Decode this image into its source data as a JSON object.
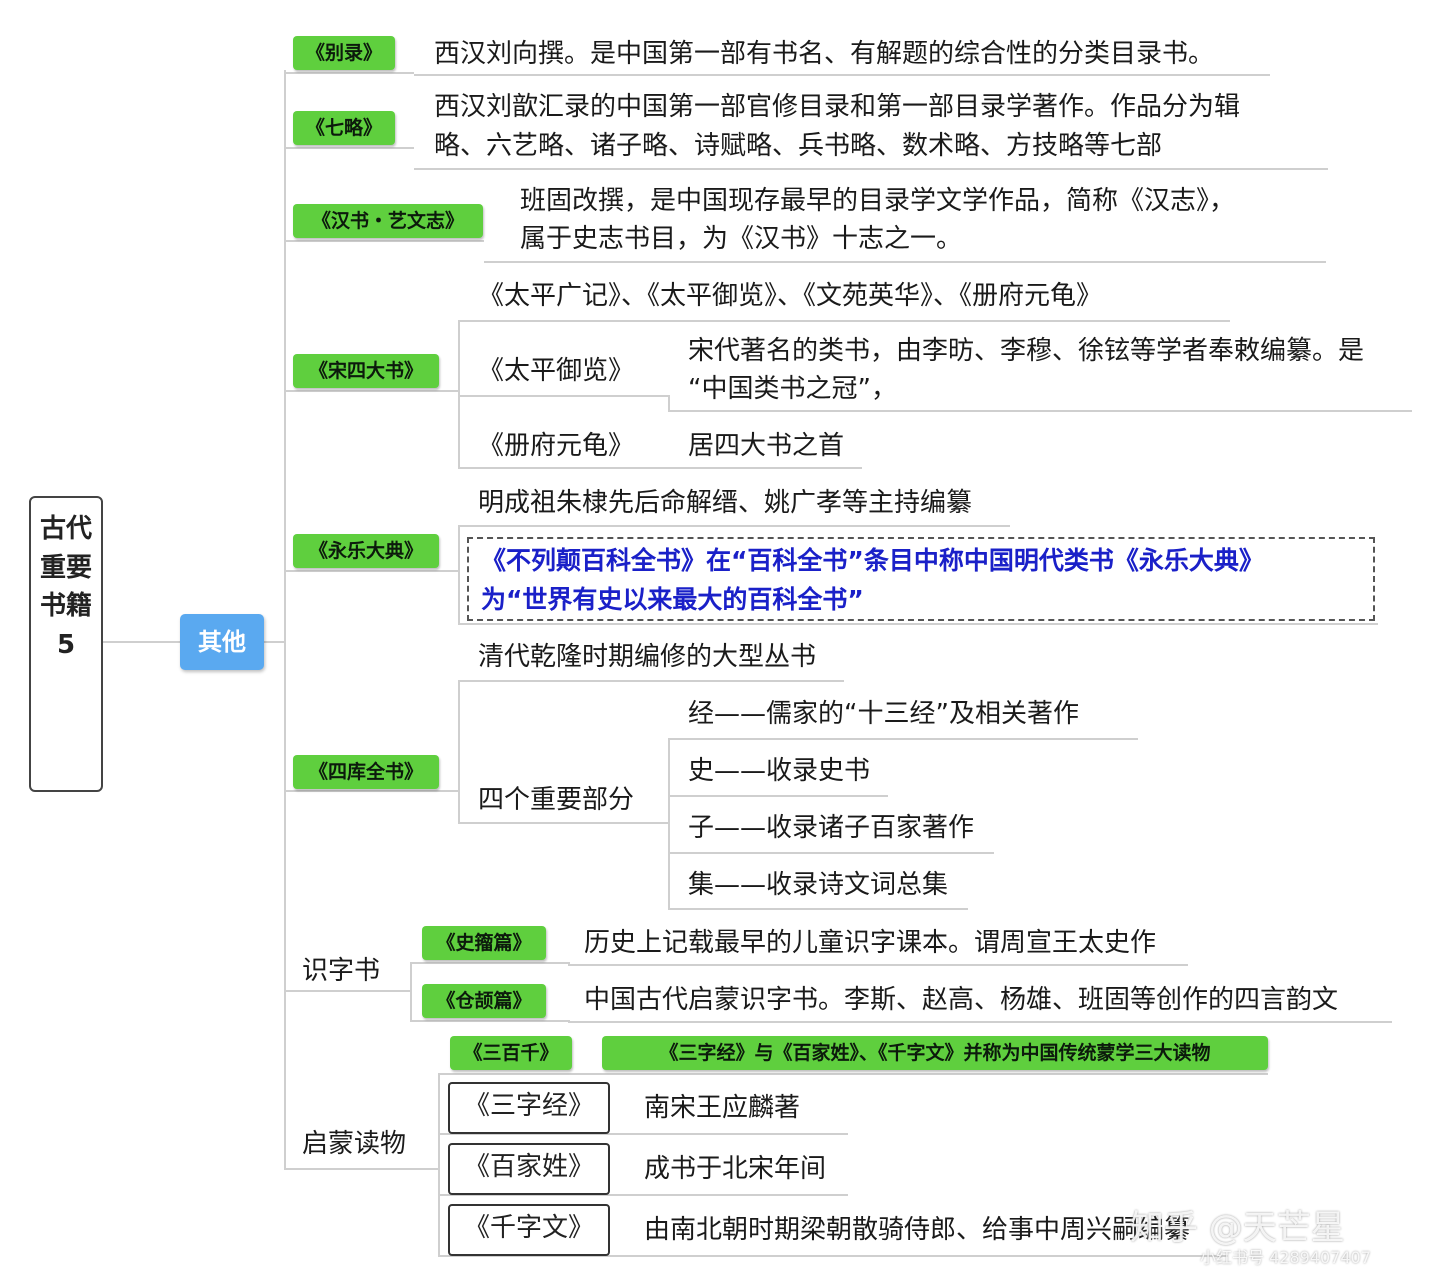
{
  "root": {
    "title": "古代重要书籍5"
  },
  "branch": {
    "label": "其他"
  },
  "bielu": {
    "tag": "《别录》",
    "desc": "西汉刘向撰。是中国第一部有书名、有解题的综合性的分类目录书。"
  },
  "qilue": {
    "tag": "《七略》",
    "desc1": "西汉刘歆汇录的中国第一部官修目录和第一部目录学著作。作品分为辑",
    "desc2": "略、六艺略、诸子略、诗赋略、兵书略、数术略、方技略等七部"
  },
  "hanshu": {
    "tag": "《汉书・艺文志》",
    "desc1": "班固改撰，是中国现存最早的目录学文学作品，简称《汉志》，",
    "desc2": "属于史志书目，为《汉书》十志之一。"
  },
  "song": {
    "tag": "《宋四大书》",
    "list": "《太平广记》、《太平御览》、《文苑英华》、《册府元龟》",
    "tpyl": "《太平御览》",
    "tpyl_desc1": "宋代著名的类书，由李昉、李穆、徐铉等学者奉敕编纂。是",
    "tpyl_desc2": "“中国类书之冠”，",
    "cfyg": "《册府元龟》",
    "cfyg_desc": "居四大书之首"
  },
  "yongle": {
    "tag": "《永乐大典》",
    "desc": "明成祖朱棣先后命解缙、姚广孝等主持编纂",
    "note1": "《不列颠百科全书》在“百科全书”条目中称中国明代类书《永乐大典》",
    "note2": "为“世界有史以来最大的百科全书”"
  },
  "siku": {
    "tag": "《四库全书》",
    "desc": "清代乾隆时期编修的大型丛书",
    "parts_label": "四个重要部分",
    "parts": [
      "经——儒家的“十三经”及相关著作",
      "史——收录史书",
      "子——收录诸子百家著作",
      "集——收录诗文词总集"
    ]
  },
  "shizi": {
    "label": "识字书",
    "a_tag": "《史籀篇》",
    "a_desc": "历史上记载最早的儿童识字课本。谓周宣王太史作",
    "b_tag": "《仓颉篇》",
    "b_desc": "中国古代启蒙识字书。李斯、赵高、杨雄、班固等创作的四言韵文"
  },
  "qimeng": {
    "label": "启蒙读物",
    "sbq_tag": "《三百千》",
    "sbq_desc": "《三字经》与《百家姓》、《千字文》并称为中国传统蒙学三大读物",
    "szj": "《三字经》",
    "szj_desc": "南宋王应麟著",
    "bjx": "《百家姓》",
    "bjx_desc": "成书于北宋年间",
    "qzw": "《千字文》",
    "qzw_desc": "由南北朝时期梁朝散骑侍郎、给事中周兴嗣编纂"
  },
  "watermark": {
    "main": "知乎 @天芒星",
    "sub": "小红书号 4289407407"
  }
}
